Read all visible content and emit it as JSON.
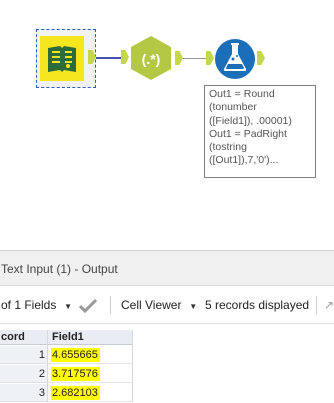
{
  "annotation": {
    "text": "Out1 = Round\n(tonumber\n([Field1]), .00001)\nOut1 = PadRight\n(tostring\n([Out1]),7,'0')..."
  },
  "results": {
    "title": "Text Input (1) - Output",
    "fields_label": "of 1 Fields",
    "cell_viewer_label": "Cell Viewer",
    "records_label": "5 records displayed",
    "columns": [
      "cord",
      "Field1"
    ],
    "rows": [
      {
        "record": "1",
        "value": "4.655665"
      },
      {
        "record": "2",
        "value": "3.717576"
      },
      {
        "record": "3",
        "value": "2.682103"
      }
    ]
  },
  "colors": {
    "input_tool": "#f5e61e",
    "regex_tool": "#b5c843",
    "formula_tool": "#1b6fb8",
    "connector": "#4456a8",
    "highlight": "#ffff00"
  },
  "icons": [
    "book-input-icon",
    "regex-icon",
    "formula-flask-icon",
    "checkmark-icon",
    "chevron-down-icon"
  ]
}
